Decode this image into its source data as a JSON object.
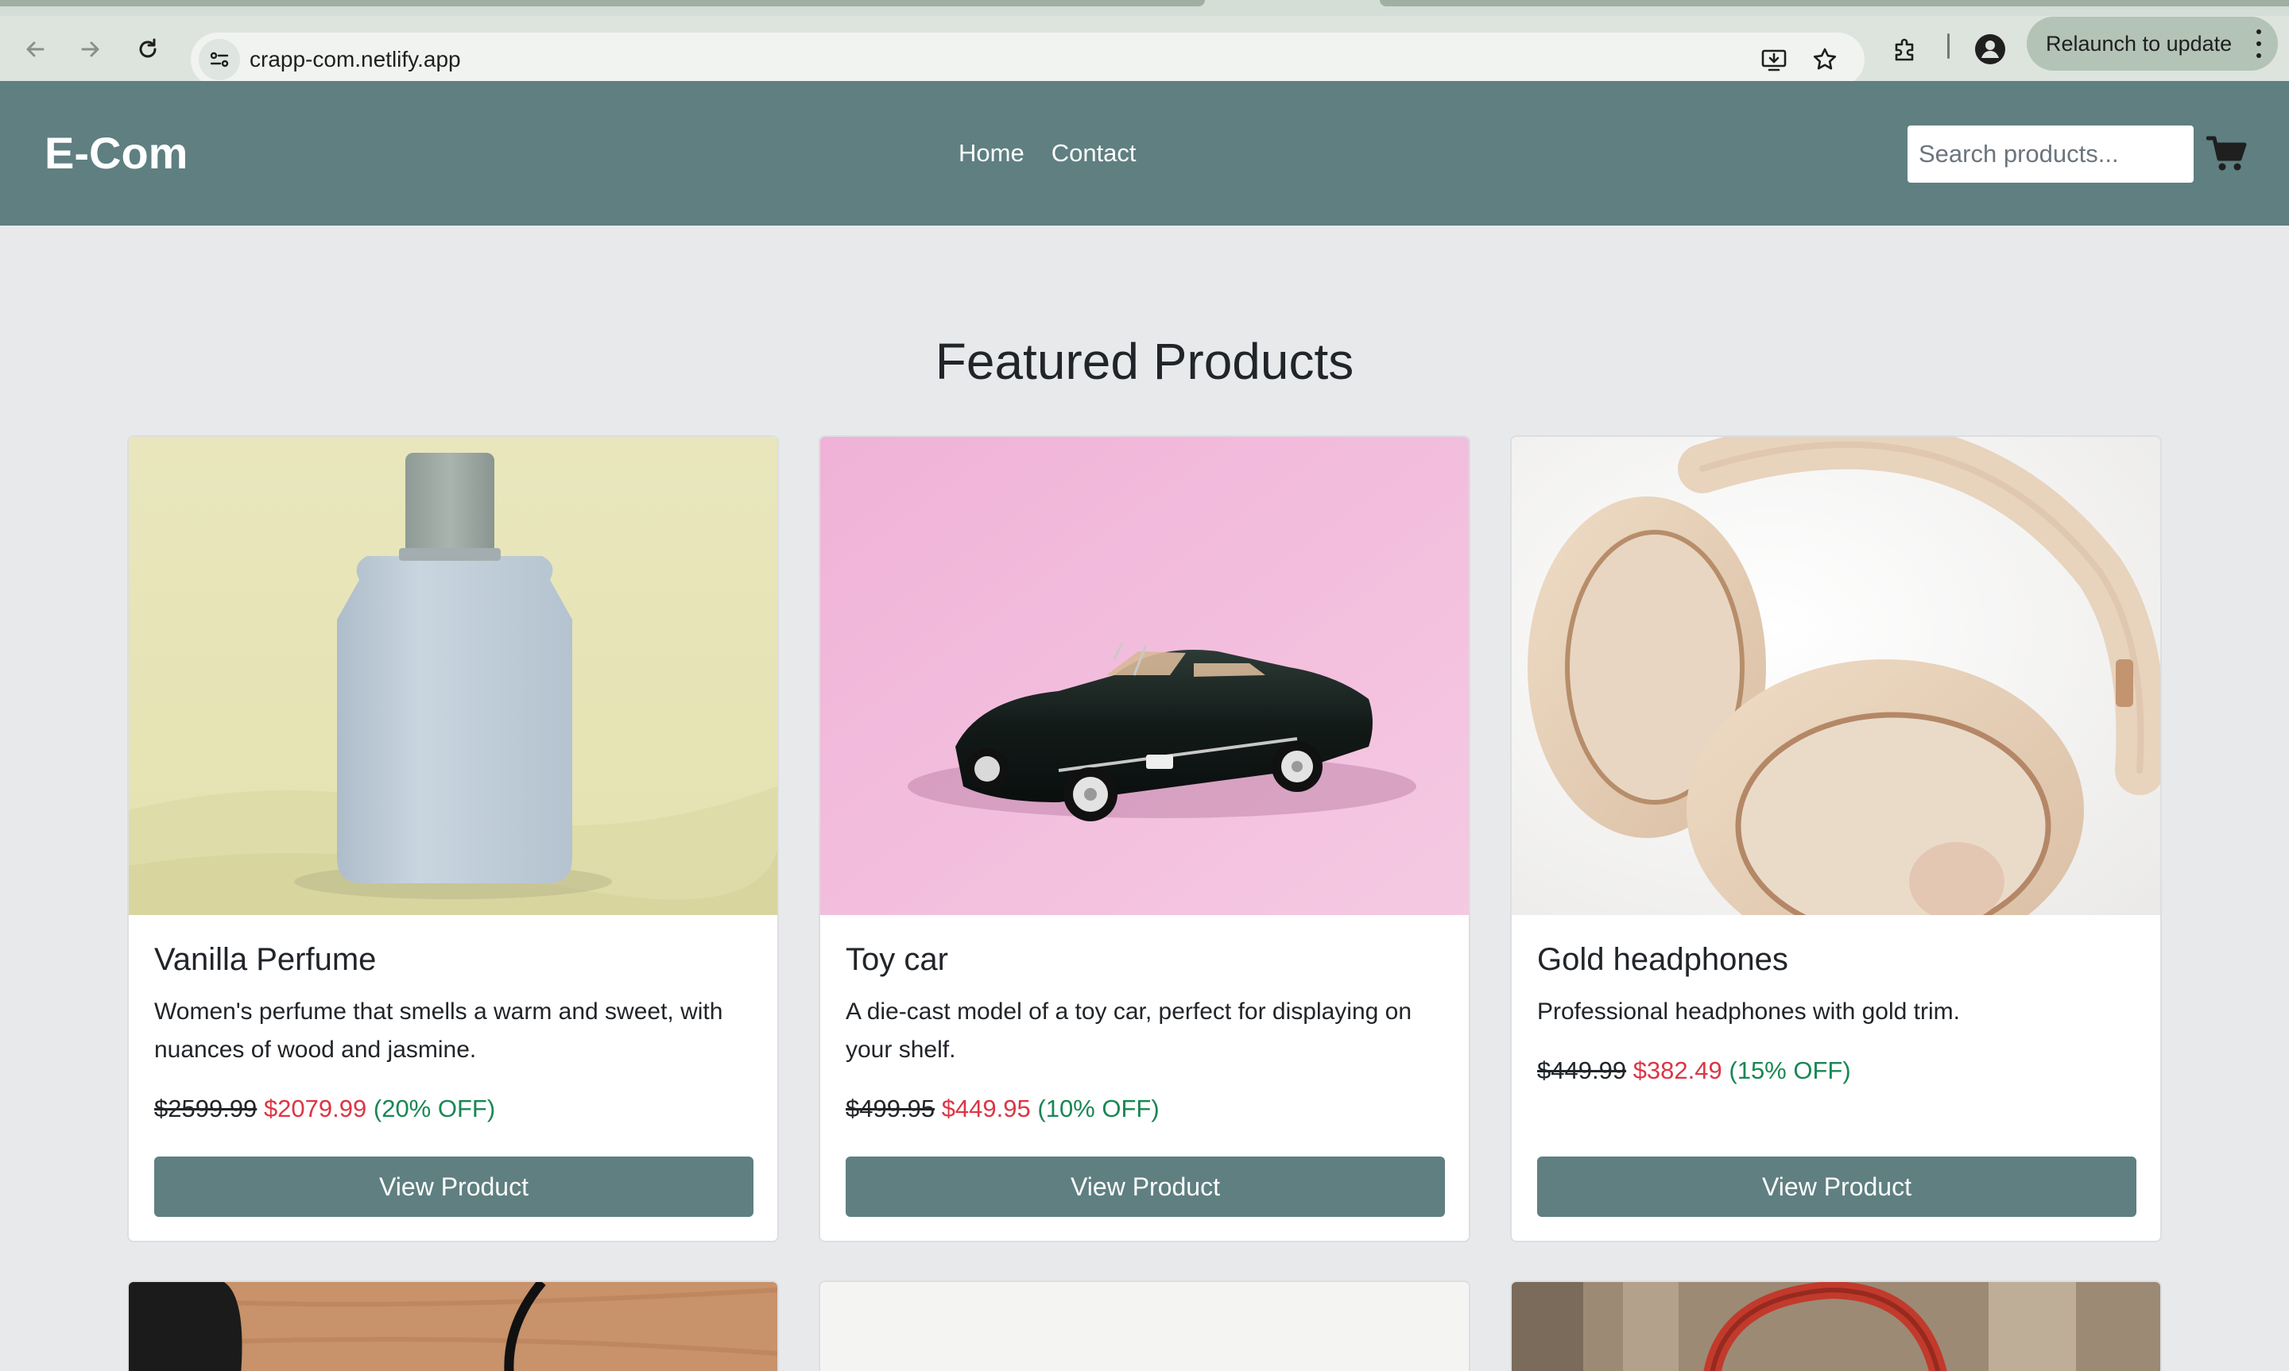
{
  "browser": {
    "url": "crapp-com.netlify.app",
    "relaunch_label": "Relaunch to update",
    "icons": [
      "back-arrow-icon",
      "forward-arrow-icon",
      "reload-icon",
      "site-info-icon",
      "install-app-icon",
      "bookmark-star-icon",
      "extensions-icon",
      "profile-icon",
      "more-menu-icon"
    ]
  },
  "header": {
    "brand": "E-Com",
    "nav": [
      {
        "label": "Home"
      },
      {
        "label": "Contact"
      }
    ],
    "search_placeholder": "Search products...",
    "cart_icon": "shopping-cart-icon",
    "background": "#5f7f81"
  },
  "main": {
    "title": "Featured Products",
    "products": [
      {
        "name": "Vanilla Perfume",
        "description": "Women's perfume that smells a warm and sweet, with nuances of wood and jasmine.",
        "original_price": "$2599.99",
        "sale_price": "$2079.99",
        "discount": "(20% OFF)",
        "button": "View Product"
      },
      {
        "name": "Toy car",
        "description": "A die-cast model of a toy car, perfect for displaying on your shelf.",
        "original_price": "$499.95",
        "sale_price": "$449.95",
        "discount": "(10% OFF)",
        "button": "View Product"
      },
      {
        "name": "Gold headphones",
        "description": "Professional headphones with gold trim.",
        "original_price": "$449.99",
        "sale_price": "$382.49",
        "discount": "(15% OFF)",
        "button": "View Product"
      }
    ]
  },
  "colors": {
    "accent": "#5f7f81",
    "page_bg": "#e8e9eb",
    "sale_price": "#dc3545",
    "discount": "#198754"
  }
}
